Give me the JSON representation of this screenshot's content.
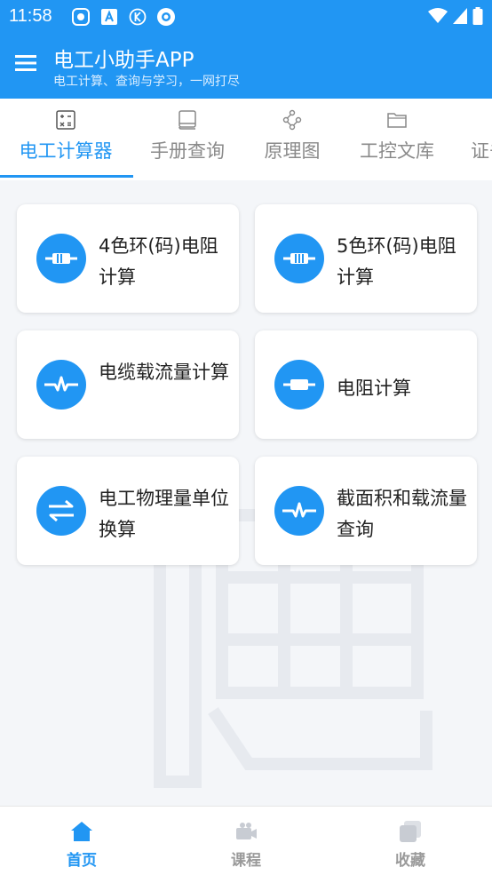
{
  "status": {
    "time": "11:58"
  },
  "app": {
    "title": "电工小助手APP",
    "subtitle": "电工计算、查询与学习，一网打尽"
  },
  "tabs": [
    {
      "label": "电工计算器",
      "icon": "calculator-icon",
      "active": true
    },
    {
      "label": "手册查询",
      "icon": "book-icon",
      "active": false
    },
    {
      "label": "原理图",
      "icon": "share-nodes-icon",
      "active": false
    },
    {
      "label": "工控文库",
      "icon": "folder-icon",
      "active": false
    },
    {
      "label": "证书",
      "icon": "certificate-icon",
      "active": false
    }
  ],
  "cards": [
    {
      "label": "4色环(码)电阻计算",
      "icon": "resistor-icon"
    },
    {
      "label": "5色环(码)电阻计算",
      "icon": "resistor-icon"
    },
    {
      "label": "电缆载流量计算",
      "icon": "pulse-icon"
    },
    {
      "label": "电阻计算",
      "icon": "resistor-icon"
    },
    {
      "label": "电工物理量单位换算",
      "icon": "swap-arrows-icon"
    },
    {
      "label": "截面积和载流量查询",
      "icon": "pulse-icon"
    }
  ],
  "nav": [
    {
      "label": "首页",
      "icon": "home-icon",
      "active": true
    },
    {
      "label": "课程",
      "icon": "video-icon",
      "active": false
    },
    {
      "label": "收藏",
      "icon": "collection-icon",
      "active": false
    }
  ],
  "colors": {
    "primary": "#2196f3",
    "inactive": "#8a8a8a",
    "background": "#f4f6f9"
  }
}
